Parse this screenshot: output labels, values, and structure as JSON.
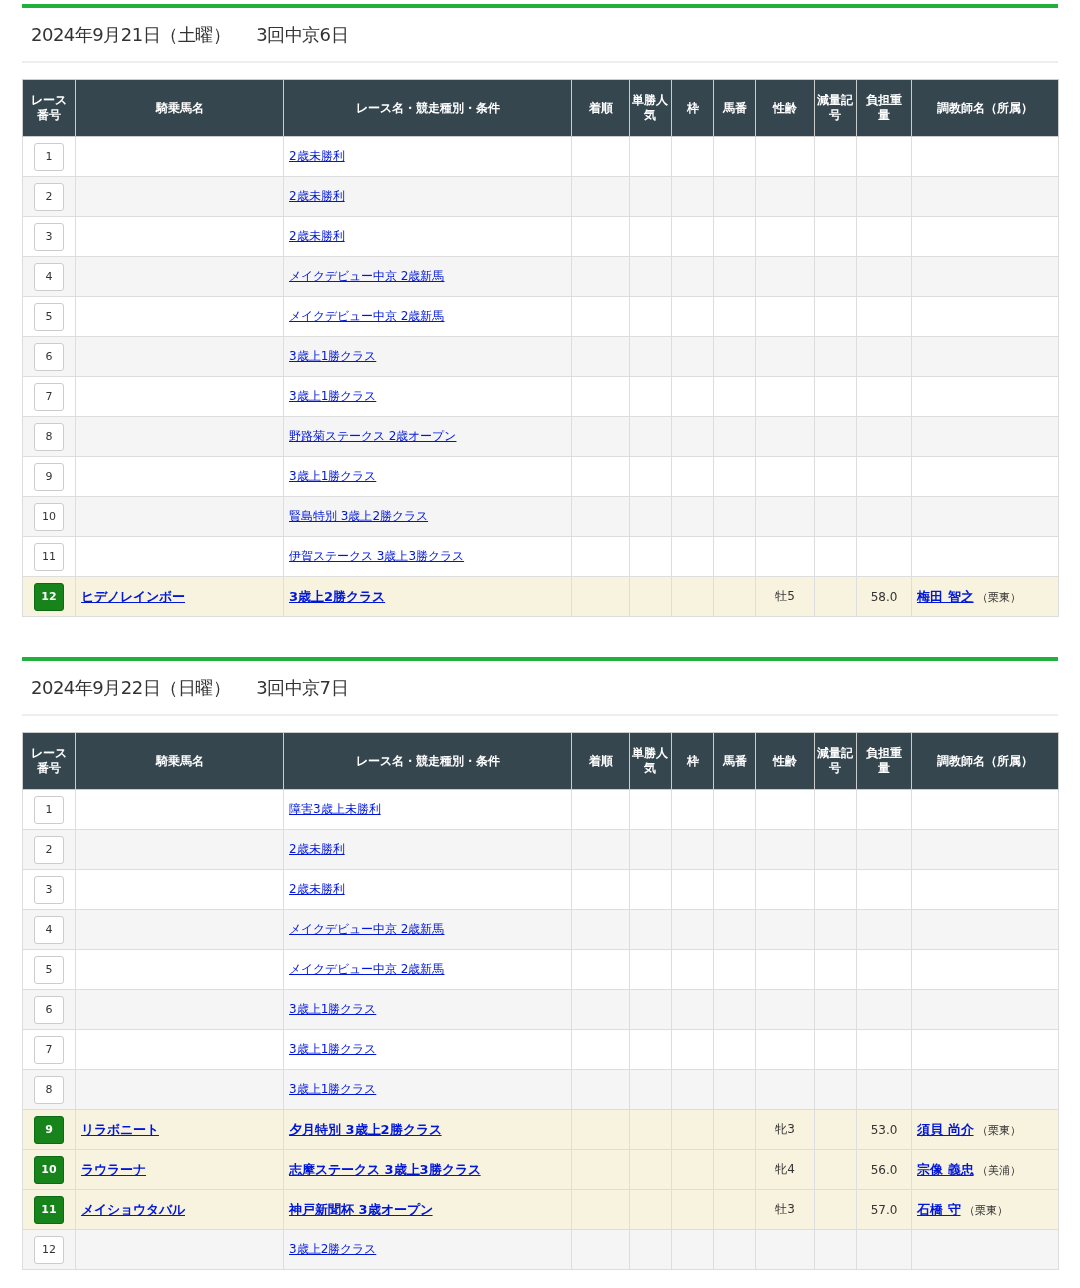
{
  "sections": [
    {
      "date": "2024年9月21日（土曜）",
      "meeting": "3回中京6日",
      "columns": [
        "レース番号",
        "騎乗馬名",
        "レース名・競走種別・条件",
        "着順",
        "単勝人気",
        "枠",
        "馬番",
        "性齢",
        "減量記号",
        "負担重量",
        "調教師名（所属）"
      ],
      "rows": [
        {
          "num": "1",
          "race": "2歳未勝利",
          "highlighted": false
        },
        {
          "num": "2",
          "race": "2歳未勝利",
          "highlighted": false
        },
        {
          "num": "3",
          "race": "2歳未勝利",
          "highlighted": false
        },
        {
          "num": "4",
          "race": "メイクデビュー中京 2歳新馬",
          "highlighted": false
        },
        {
          "num": "5",
          "race": "メイクデビュー中京 2歳新馬",
          "highlighted": false
        },
        {
          "num": "6",
          "race": "3歳上1勝クラス",
          "highlighted": false
        },
        {
          "num": "7",
          "race": "3歳上1勝クラス",
          "highlighted": false
        },
        {
          "num": "8",
          "race": "野路菊ステークス 2歳オープン",
          "highlighted": false
        },
        {
          "num": "9",
          "race": "3歳上1勝クラス",
          "highlighted": false
        },
        {
          "num": "10",
          "race": "賢島特別 3歳上2勝クラス",
          "highlighted": false
        },
        {
          "num": "11",
          "race": "伊賀ステークス 3歳上3勝クラス",
          "highlighted": false
        },
        {
          "num": "12",
          "horse": "ヒデノレインボー",
          "race": "3歳上2勝クラス",
          "sex_age": "牡5",
          "weight": "58.0",
          "trainer": "梅田 智之",
          "affiliation": "（栗東）",
          "highlighted": true
        }
      ]
    },
    {
      "date": "2024年9月22日（日曜）",
      "meeting": "3回中京7日",
      "columns": [
        "レース番号",
        "騎乗馬名",
        "レース名・競走種別・条件",
        "着順",
        "単勝人気",
        "枠",
        "馬番",
        "性齢",
        "減量記号",
        "負担重量",
        "調教師名（所属）"
      ],
      "rows": [
        {
          "num": "1",
          "race": "障害3歳上未勝利",
          "highlighted": false
        },
        {
          "num": "2",
          "race": "2歳未勝利",
          "highlighted": false
        },
        {
          "num": "3",
          "race": "2歳未勝利",
          "highlighted": false
        },
        {
          "num": "4",
          "race": "メイクデビュー中京 2歳新馬",
          "highlighted": false
        },
        {
          "num": "5",
          "race": "メイクデビュー中京 2歳新馬",
          "highlighted": false
        },
        {
          "num": "6",
          "race": "3歳上1勝クラス",
          "highlighted": false
        },
        {
          "num": "7",
          "race": "3歳上1勝クラス",
          "highlighted": false
        },
        {
          "num": "8",
          "race": "3歳上1勝クラス",
          "highlighted": false
        },
        {
          "num": "9",
          "horse": "リラボニート",
          "race": "夕月特別 3歳上2勝クラス",
          "sex_age": "牝3",
          "weight": "53.0",
          "trainer": "須貝 尚介",
          "affiliation": "（栗東）",
          "highlighted": true
        },
        {
          "num": "10",
          "horse": "ラウラーナ",
          "race": "志摩ステークス 3歳上3勝クラス",
          "sex_age": "牝4",
          "weight": "56.0",
          "trainer": "宗像 義忠",
          "affiliation": "（美浦）",
          "highlighted": true
        },
        {
          "num": "11",
          "horse": "メイショウタバル",
          "race": "神戸新聞杯 3歳オープン",
          "sex_age": "牡3",
          "weight": "57.0",
          "trainer": "石橋 守",
          "affiliation": "（栗東）",
          "highlighted": true
        },
        {
          "num": "12",
          "race": "3歳上2勝クラス",
          "highlighted": false
        }
      ]
    }
  ]
}
